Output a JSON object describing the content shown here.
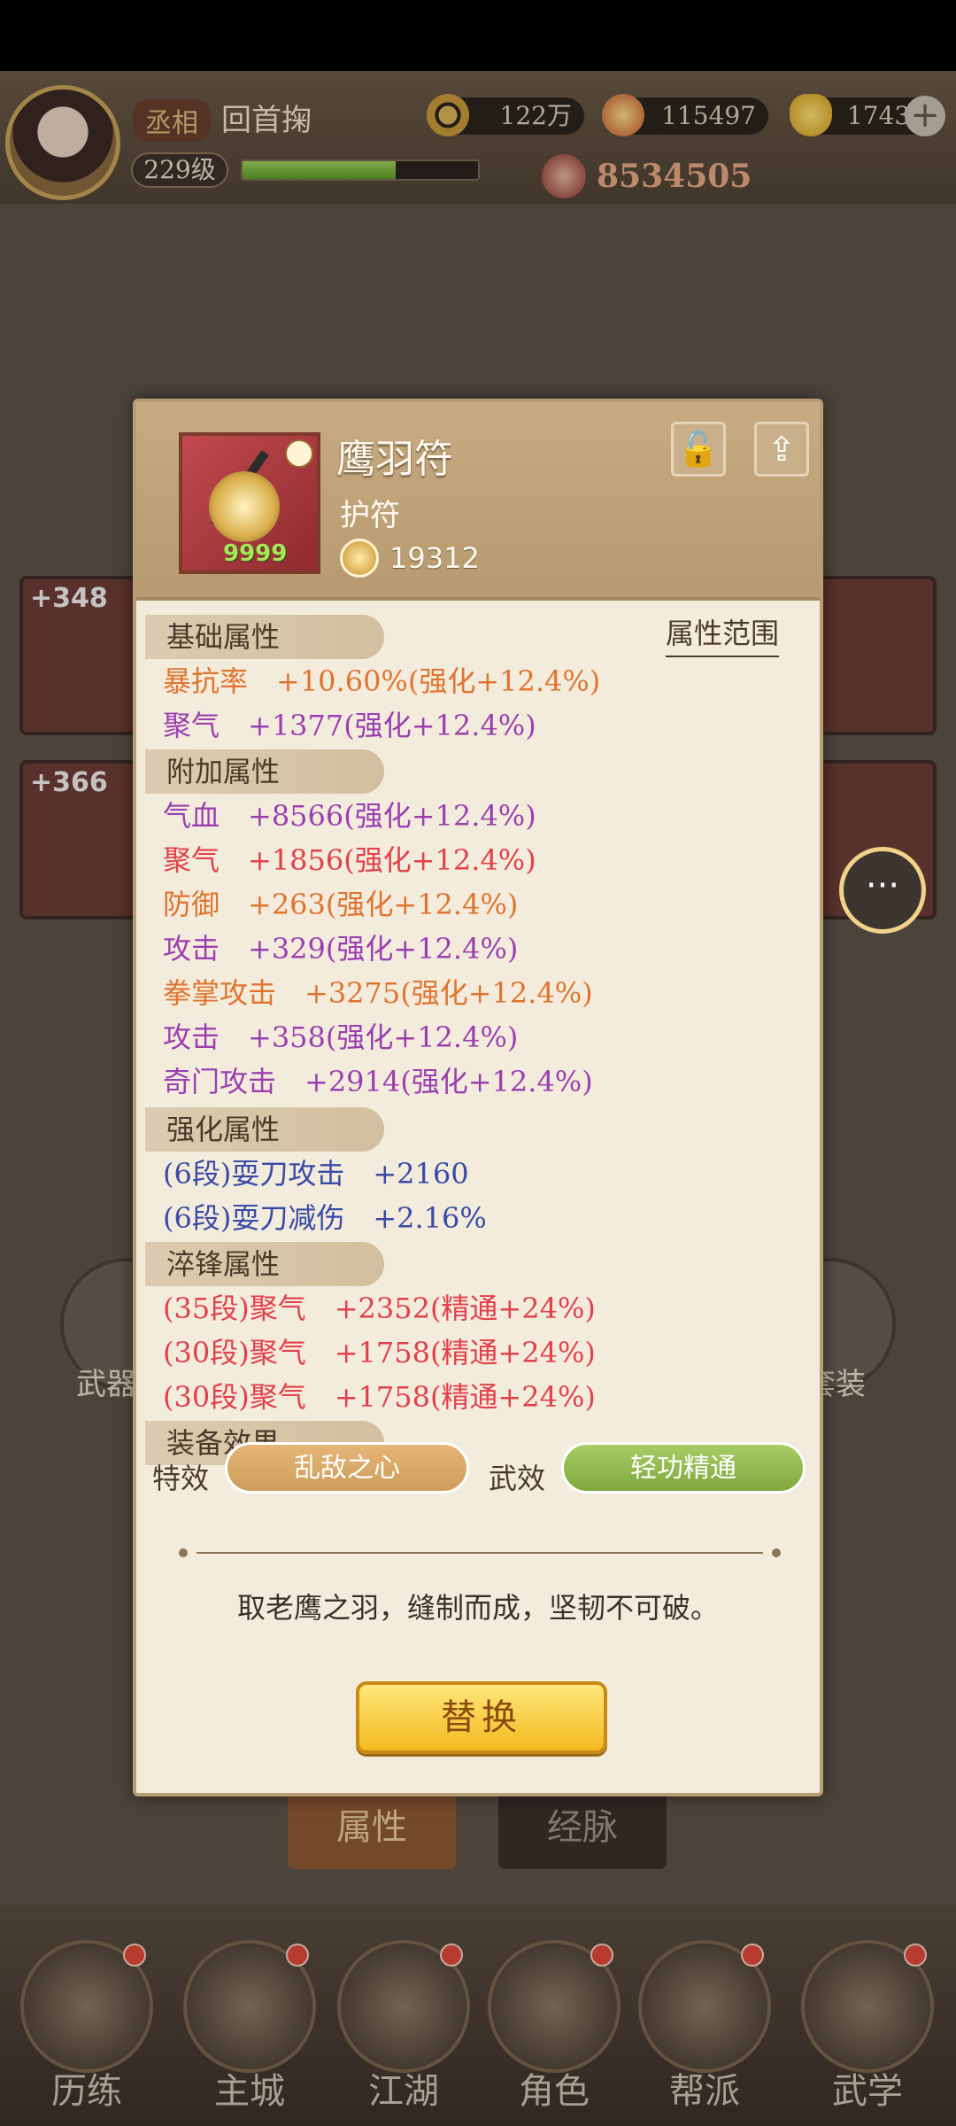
{
  "player": {
    "rank": "丞相",
    "name": "回首掬",
    "level": "229级",
    "exp_fraction": 0.65,
    "power": "8534505"
  },
  "currencies": {
    "copper": "122万",
    "jade": "115497",
    "gold": "17434"
  },
  "background": {
    "slots": [
      "+348",
      "+366"
    ],
    "side_left_label": "武器",
    "side_right_label": "套装",
    "tabs": {
      "attributes": "属性",
      "meridian": "经脉"
    }
  },
  "bottom_nav": [
    {
      "label": "历练"
    },
    {
      "label": "主城"
    },
    {
      "label": "江湖"
    },
    {
      "label": "角色"
    },
    {
      "label": "帮派"
    },
    {
      "label": "武学"
    }
  ],
  "item": {
    "name": "鹰羽符",
    "type": "护符",
    "count": "9999",
    "score": "19312"
  },
  "panel": {
    "attr_range_link": "属性范围",
    "sections": {
      "base": "基础属性",
      "extra": "附加属性",
      "enhance": "强化属性",
      "temper": "淬锋属性",
      "effect": "装备效果"
    },
    "base_attrs": [
      {
        "text": "暴抗率　+10.60%(强化+12.4%)",
        "color": "orange"
      },
      {
        "text": "聚气　+1377(强化+12.4%)",
        "color": "purple"
      }
    ],
    "extra_attrs": [
      {
        "text": "气血　+8566(强化+12.4%)",
        "color": "purple"
      },
      {
        "text": "聚气　+1856(强化+12.4%)",
        "color": "red"
      },
      {
        "text": "防御　+263(强化+12.4%)",
        "color": "orange"
      },
      {
        "text": "攻击　+329(强化+12.4%)",
        "color": "purple"
      },
      {
        "text": "拳掌攻击　+3275(强化+12.4%)",
        "color": "orange"
      },
      {
        "text": "攻击　+358(强化+12.4%)",
        "color": "purple"
      },
      {
        "text": "奇门攻击　+2914(强化+12.4%)",
        "color": "purple"
      }
    ],
    "enhance_attrs": [
      {
        "text": "(6段)耍刀攻击　+2160",
        "color": "blue"
      },
      {
        "text": "(6段)耍刀减伤　+2.16%",
        "color": "blue"
      }
    ],
    "temper_attrs": [
      {
        "text": "(35段)聚气　+2352(精通+24%)",
        "color": "red"
      },
      {
        "text": "(30段)聚气　+1758(精通+24%)",
        "color": "red"
      },
      {
        "text": "(30段)聚气　+1758(精通+24%)",
        "color": "red"
      }
    ],
    "effects": {
      "special_label": "特效",
      "special_value": "乱敌之心",
      "martial_label": "武效",
      "martial_value": "轻功精通"
    },
    "description": "取老鹰之羽，缝制而成，坚韧不可破。",
    "replace_button": "替换"
  },
  "colors": {
    "orange": "#e0742f",
    "purple": "#9b3fb0",
    "red": "#e2404a",
    "blue": "#3a4aa8"
  }
}
